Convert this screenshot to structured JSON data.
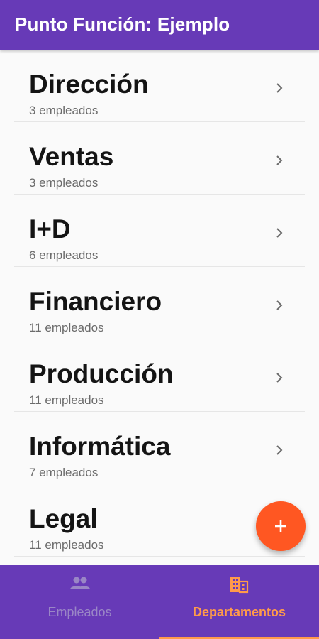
{
  "app": {
    "title": "Punto Función: Ejemplo"
  },
  "departments": [
    {
      "name": "Dirección",
      "count": "3 empleados"
    },
    {
      "name": "Ventas",
      "count": "3 empleados"
    },
    {
      "name": "I+D",
      "count": "6 empleados"
    },
    {
      "name": "Financiero",
      "count": "11 empleados"
    },
    {
      "name": "Producción",
      "count": "11 empleados"
    },
    {
      "name": "Informática",
      "count": "7 empleados"
    },
    {
      "name": "Legal",
      "count": "11 empleados"
    }
  ],
  "fab": {
    "icon": "add-icon",
    "color": "#ff5722"
  },
  "bottom_nav": {
    "tabs": [
      {
        "label": "Empleados",
        "icon": "people-icon",
        "active": false
      },
      {
        "label": "Departamentos",
        "icon": "building-icon",
        "active": true
      }
    ]
  },
  "colors": {
    "primary": "#673ab7",
    "accent": "#ff9a4a",
    "fab": "#ff5722",
    "background": "#fafafa"
  }
}
